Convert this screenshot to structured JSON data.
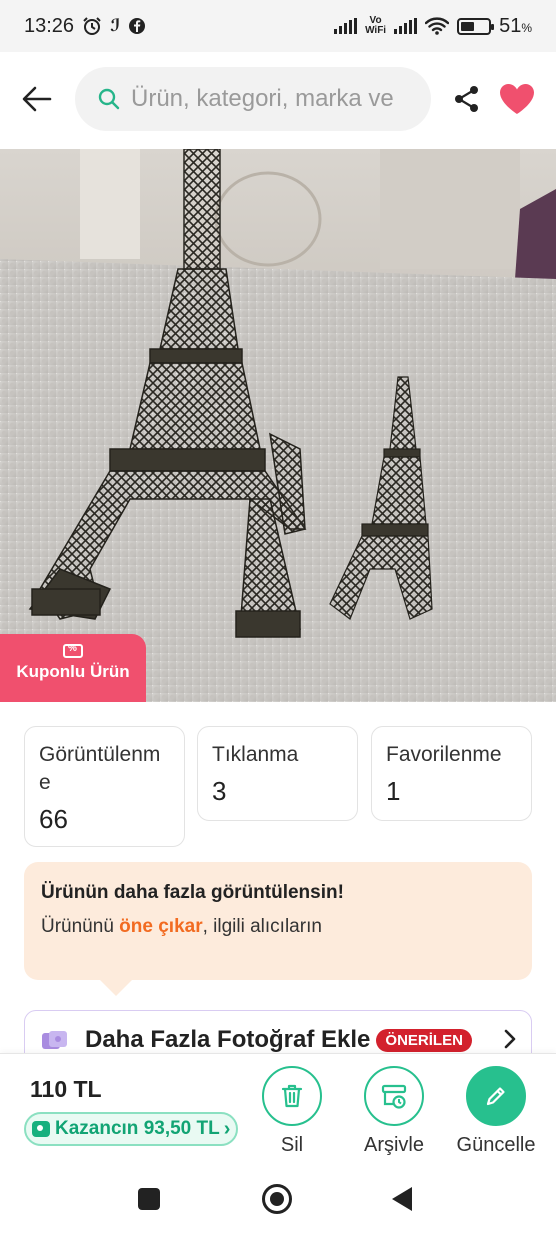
{
  "status_bar": {
    "time": "13:26",
    "vowifi_top": "Vo",
    "vowifi_bottom": "WiFi",
    "battery_percent": "51",
    "battery_unit": "%",
    "battery_level": 0.51
  },
  "header": {
    "search_placeholder": "Ürün, kategori, marka ve"
  },
  "product": {
    "coupon_badge": "Kuponlu Ürün"
  },
  "stats": [
    {
      "label": "Görüntülenme",
      "value": "66"
    },
    {
      "label": "Tıklanma",
      "value": "3"
    },
    {
      "label": "Favorilenme",
      "value": "1"
    }
  ],
  "promo": {
    "title": "Ürünün daha fazla görüntülensin!",
    "text_before": "Ürününü ",
    "highlight": "öne çıkar",
    "text_after": ", ilgili alıcıların"
  },
  "suggestion": {
    "label": "Daha Fazla Fotoğraf Ekle",
    "badge": "ÖNERİLEN"
  },
  "bottom_bar": {
    "price": "110 TL",
    "earnings": "Kazancın 93,50 TL",
    "actions": [
      {
        "label": "Sil",
        "icon": "trash-icon"
      },
      {
        "label": "Arşivle",
        "icon": "archive-icon"
      },
      {
        "label": "Güncelle",
        "icon": "pencil-icon"
      }
    ]
  },
  "colors": {
    "accent_green": "#27c08e",
    "coupon_pink": "#f0506e",
    "heart": "#f0506e",
    "promo_highlight": "#f26b21",
    "badge_red": "#d3212d"
  }
}
